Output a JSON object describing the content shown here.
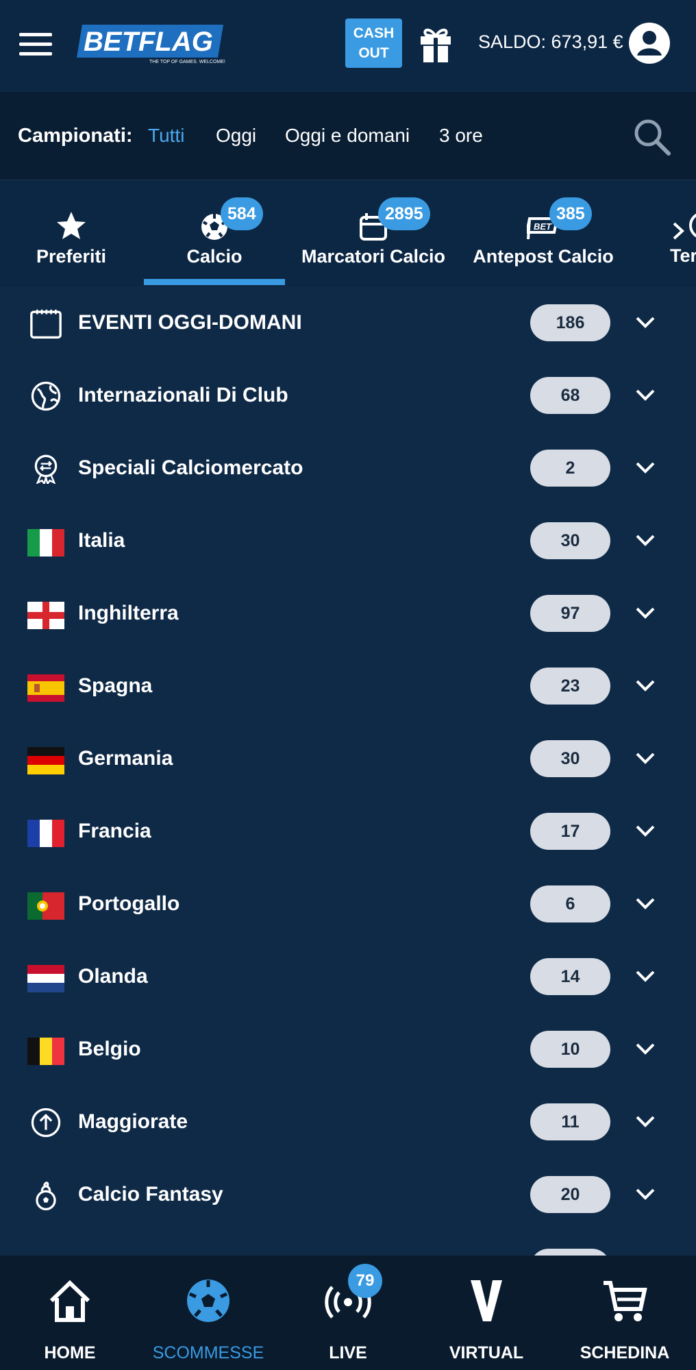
{
  "header": {
    "logo_text": "BETFLAG",
    "logo_tagline": "THE TOP OF GAMES. WELCOME!",
    "cashout_line1": "CASH",
    "cashout_line2": "OUT",
    "saldo": "SALDO: 673,91 €"
  },
  "filters": {
    "label": "Campionati:",
    "options": [
      "Tutti",
      "Oggi",
      "Oggi e domani",
      "3 ore"
    ],
    "active": "Tutti"
  },
  "tabs": [
    {
      "label": "Preferiti",
      "icon": "star-icon"
    },
    {
      "label": "Calcio",
      "badge": "584",
      "icon": "soccer-ball-icon",
      "active": true
    },
    {
      "label": "Marcatori Calcio",
      "badge": "2895",
      "icon": "calendar-ball-icon"
    },
    {
      "label": "Antepost Calcio",
      "badge": "385",
      "icon": "flag-icon"
    },
    {
      "label": "Ter",
      "icon": "ball-icon"
    }
  ],
  "list": [
    {
      "label": "EVENTI OGGI-DOMANI",
      "count": "186",
      "icon": "calendar-icon"
    },
    {
      "label": "Internazionali Di Club",
      "count": "68",
      "icon": "globe-icon"
    },
    {
      "label": "Speciali Calciomercato",
      "count": "2",
      "icon": "transfer-badge-icon"
    },
    {
      "label": "Italia",
      "count": "30",
      "icon": "flag-italy-icon"
    },
    {
      "label": "Inghilterra",
      "count": "97",
      "icon": "flag-england-icon"
    },
    {
      "label": "Spagna",
      "count": "23",
      "icon": "flag-spain-icon"
    },
    {
      "label": "Germania",
      "count": "30",
      "icon": "flag-germany-icon"
    },
    {
      "label": "Francia",
      "count": "17",
      "icon": "flag-france-icon"
    },
    {
      "label": "Portogallo",
      "count": "6",
      "icon": "flag-portugal-icon"
    },
    {
      "label": "Olanda",
      "count": "14",
      "icon": "flag-netherlands-icon"
    },
    {
      "label": "Belgio",
      "count": "10",
      "icon": "flag-belgium-icon"
    },
    {
      "label": "Maggiorate",
      "count": "11",
      "icon": "arrow-up-circle-icon"
    },
    {
      "label": "Calcio Fantasy",
      "count": "20",
      "icon": "fantasy-ball-icon"
    }
  ],
  "bottom_nav": [
    {
      "label": "HOME",
      "icon": "home-icon"
    },
    {
      "label": "SCOMMESSE",
      "icon": "soccer-ball-icon",
      "active": true
    },
    {
      "label": "LIVE",
      "icon": "live-signal-icon",
      "badge": "79"
    },
    {
      "label": "VIRTUAL",
      "icon": "virtual-v-icon"
    },
    {
      "label": "SCHEDINA",
      "icon": "cart-icon"
    }
  ],
  "colors": {
    "accent": "#3a9be2",
    "header_bg": "#0c2744",
    "row_bg": "#0f2a47",
    "count_bg": "#d8dde5"
  }
}
